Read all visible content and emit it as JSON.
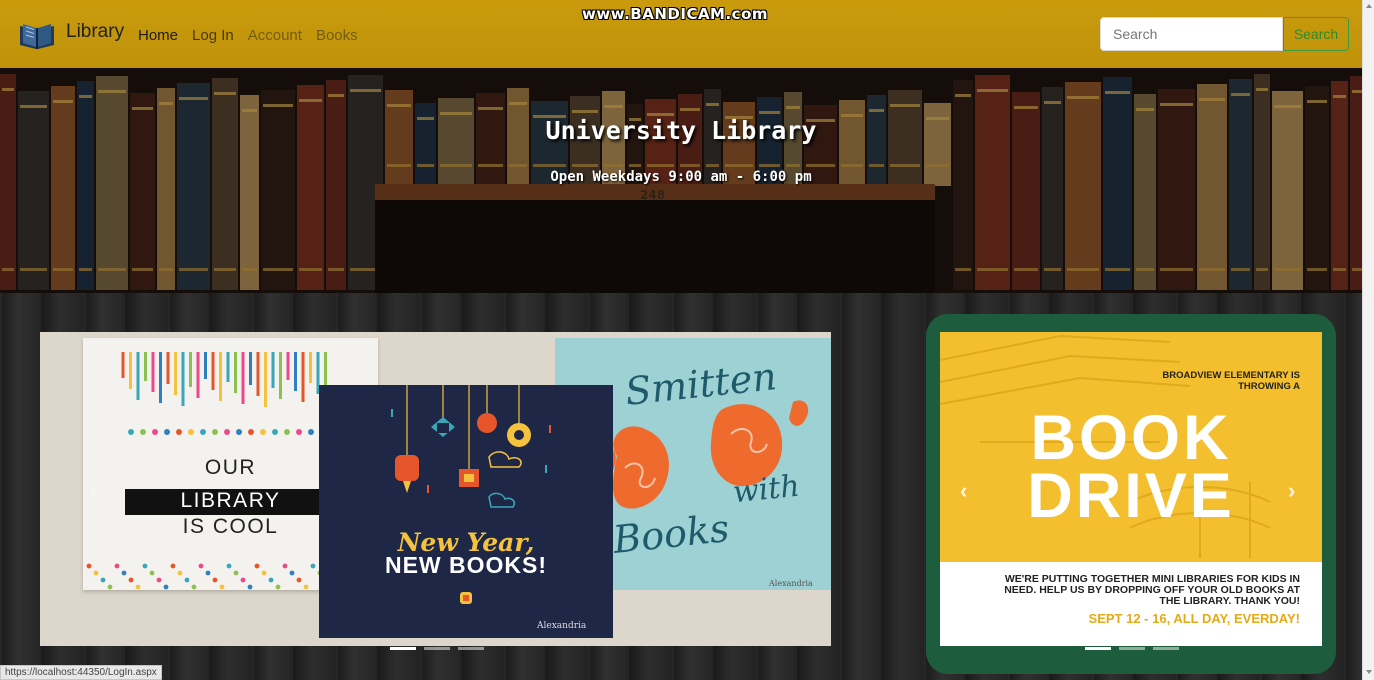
{
  "watermark": "www.BANDICAM.com",
  "nav": {
    "brand": "Library",
    "links": [
      "Home",
      "Log In",
      "Account",
      "Books"
    ],
    "search_placeholder": "Search",
    "search_button": "Search"
  },
  "hero": {
    "title": "University Library",
    "subtitle": "Open Weekdays 9:00 am - 6:00 pm",
    "shelf_number": "248"
  },
  "carousel_left": {
    "poster_cool": {
      "line1": "OUR",
      "line2": "LIBRARY",
      "line3": "IS COOL"
    },
    "poster_new_year": {
      "line1": "New Year,",
      "line2": "NEW BOOKS!",
      "brand": "Alexandria"
    },
    "poster_smitten": {
      "word1": "Smitten",
      "word2": "with",
      "word3": "Books",
      "brand": "Alexandria"
    },
    "slide_count": 3,
    "active_slide": 0
  },
  "carousel_right": {
    "header": "BROADVIEW ELEMENTARY IS THROWING A",
    "big1": "BOOK",
    "big2": "DRIVE",
    "copy": "WE'RE PUTTING TOGETHER MINI LIBRARIES FOR KIDS IN NEED. HELP US BY DROPPING OFF YOUR OLD BOOKS AT THE LIBRARY. THANK YOU!",
    "date": "SEPT 12 - 16, ALL DAY, EVERDAY!",
    "slide_count": 3,
    "active_slide": 0
  },
  "status_bar": "https://localhost:44350/LogIn.aspx",
  "colors": {
    "navbar": "#c99b0c",
    "search_green": "#2e8b2e",
    "book_drive_yellow": "#f3bf2e",
    "book_drive_frame": "#1d5d3e",
    "new_year_navy": "#1f2747",
    "smitten_teal": "#9ed1d3"
  }
}
